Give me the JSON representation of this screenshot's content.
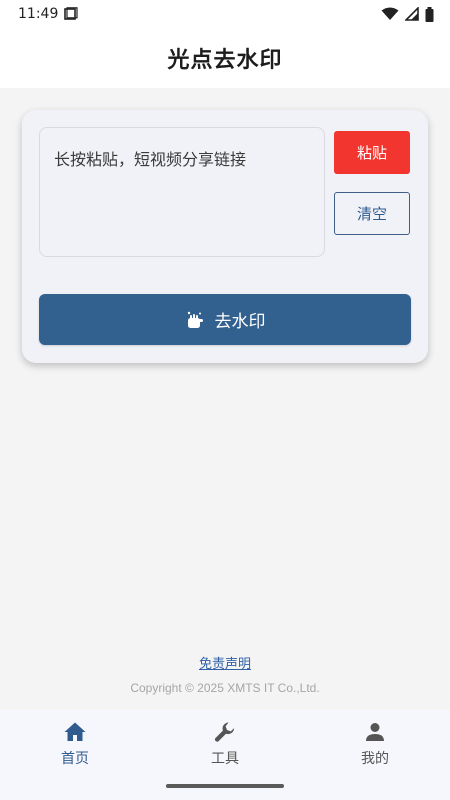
{
  "status_bar": {
    "time": "11:49"
  },
  "app_bar": {
    "title": "光点去水印"
  },
  "card": {
    "input_placeholder": "长按粘贴，短视频分享链接",
    "paste_label": "粘贴",
    "clear_label": "清空",
    "remove_label": "去水印"
  },
  "footer": {
    "disclaimer": "免责声明",
    "copyright": "Copyright © 2025 XMTS IT Co.,Ltd."
  },
  "bottom_nav": {
    "items": [
      {
        "label": "首页",
        "icon": "home-icon",
        "active": true
      },
      {
        "label": "工具",
        "icon": "wrench-icon",
        "active": false
      },
      {
        "label": "我的",
        "icon": "person-icon",
        "active": false
      }
    ]
  },
  "colors": {
    "primary": "#33618f",
    "paste_red": "#f2352f",
    "link_blue": "#2f5fa7"
  }
}
